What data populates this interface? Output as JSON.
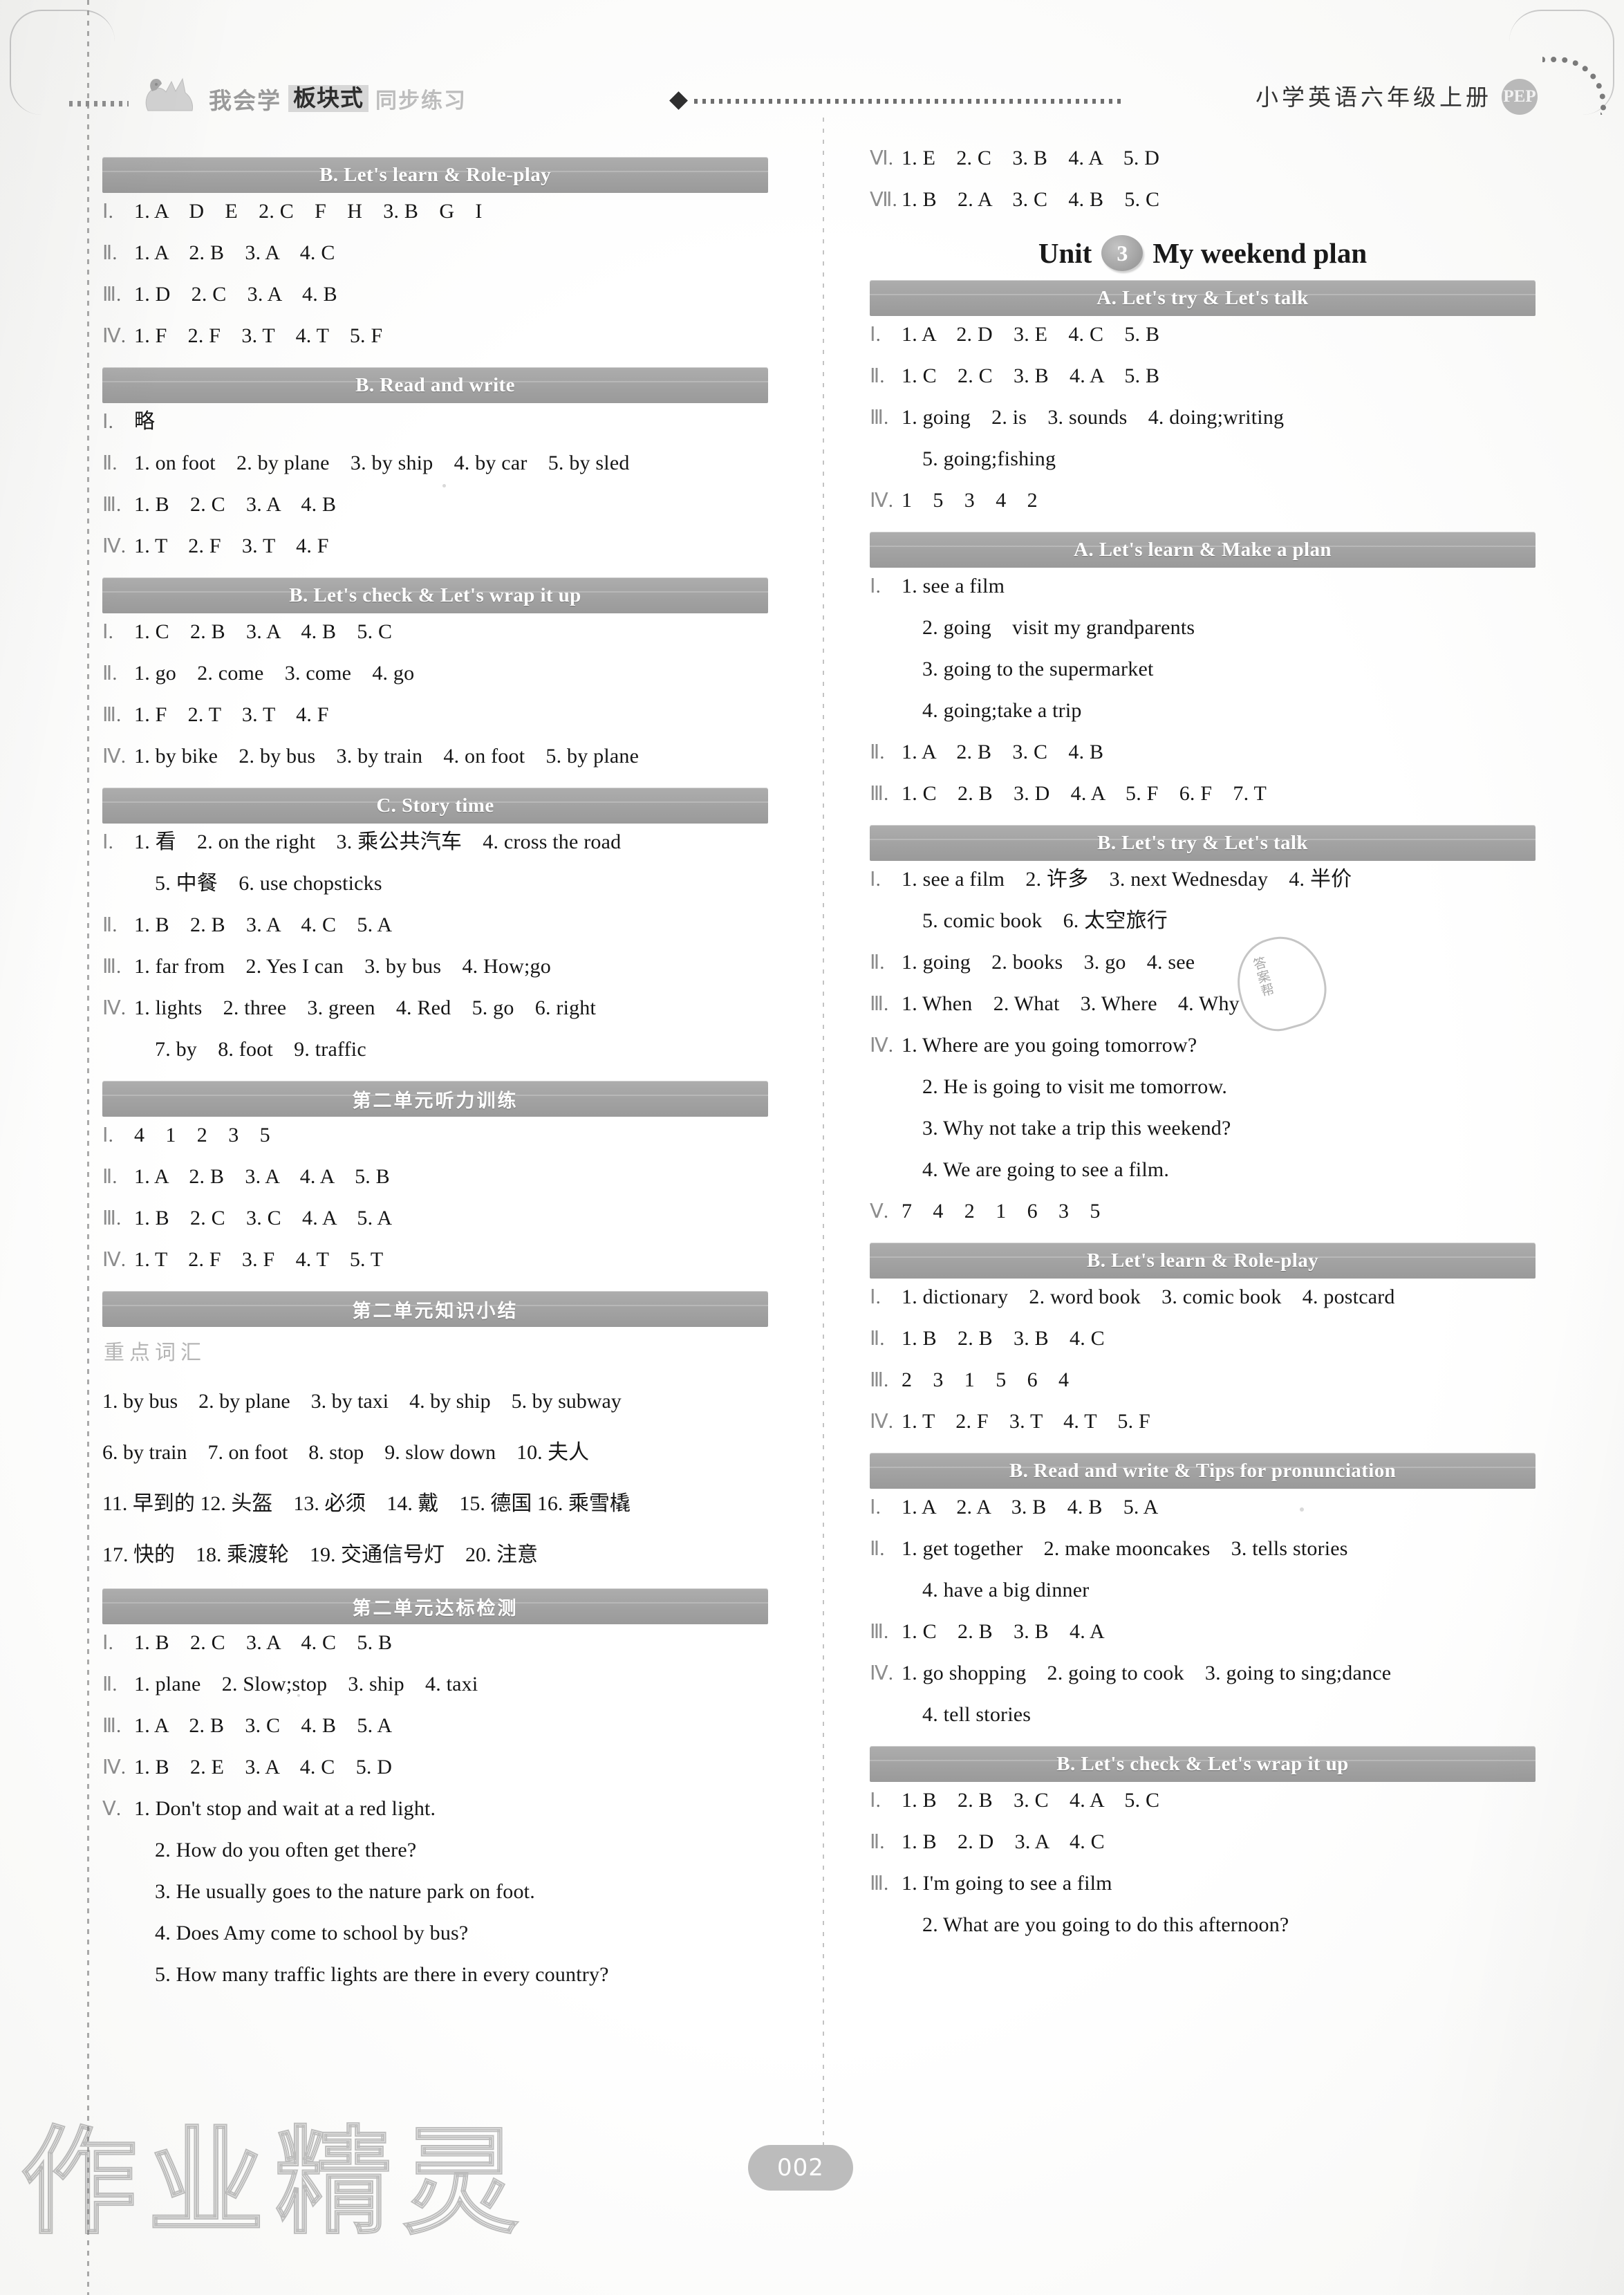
{
  "header": {
    "logo_cn": "我会学",
    "badge_cn": "板块式",
    "sub_cn": "同步练习",
    "book_title": "小学英语六年级上册",
    "publisher_badge": "PEP"
  },
  "page_number": "002",
  "watermark": {
    "text": "作业精灵",
    "stamp": "答案帮"
  },
  "left_column": [
    {
      "type": "banner",
      "label": "B. Let's learn & Role-play"
    },
    {
      "type": "row",
      "num": "Ⅰ",
      "answer": "1. A　D　E　2. C　F　H　3. B　G　I"
    },
    {
      "type": "row",
      "num": "Ⅱ",
      "answer": "1. A　2. B　3. A　4. C"
    },
    {
      "type": "row",
      "num": "Ⅲ",
      "answer": "1. D　2. C　3. A　4. B"
    },
    {
      "type": "row",
      "num": "Ⅳ",
      "answer": "1. F　2. F　3. T　4. T　5. F"
    },
    {
      "type": "banner",
      "label": "B. Read and write"
    },
    {
      "type": "row",
      "num": "Ⅰ",
      "answer": "略"
    },
    {
      "type": "row",
      "num": "Ⅱ",
      "answer": "1. on foot　2. by plane　3. by ship　4. by car　5. by sled"
    },
    {
      "type": "row",
      "num": "Ⅲ",
      "answer": "1. B　2. C　3. A　4. B"
    },
    {
      "type": "row",
      "num": "Ⅳ",
      "answer": "1. T　2. F　3. T　4. F"
    },
    {
      "type": "banner",
      "label": "B. Let's check & Let's wrap it up"
    },
    {
      "type": "row",
      "num": "Ⅰ",
      "answer": "1. C　2. B　3. A　4. B　5. C"
    },
    {
      "type": "row",
      "num": "Ⅱ",
      "answer": "1. go　2. come　3. come　4. go"
    },
    {
      "type": "row",
      "num": "Ⅲ",
      "answer": "1. F　2. T　3. T　4. F"
    },
    {
      "type": "row",
      "num": "Ⅳ",
      "answer": "1. by bike　2. by bus　3. by train　4. on foot　5. by plane"
    },
    {
      "type": "banner",
      "label": "C. Story time"
    },
    {
      "type": "row",
      "num": "Ⅰ",
      "answer": "1. 看　2. on the right　3. 乘公共汽车　4. cross the road"
    },
    {
      "type": "cont",
      "answer": "5. 中餐　6. use chopsticks"
    },
    {
      "type": "row",
      "num": "Ⅱ",
      "answer": "1. B　2. B　3. A　4. C　5. A"
    },
    {
      "type": "row",
      "num": "Ⅲ",
      "answer": "1. far from　2. Yes I can　3. by bus　4. How;go"
    },
    {
      "type": "row",
      "num": "Ⅳ",
      "answer": "1. lights　2. three　3. green　4. Red　5. go　6. right"
    },
    {
      "type": "cont",
      "answer": "7. by　8. foot　9. traffic"
    },
    {
      "type": "banner",
      "label": "第二单元听力训练",
      "cn": true
    },
    {
      "type": "row",
      "num": "Ⅰ",
      "answer": "4　1　2　3　5"
    },
    {
      "type": "row",
      "num": "Ⅱ",
      "answer": "1. A　2. B　3. A　4. A　5. B"
    },
    {
      "type": "row",
      "num": "Ⅲ",
      "answer": "1. B　2. C　3. C　4. A　5. A"
    },
    {
      "type": "row",
      "num": "Ⅳ",
      "answer": "1. T　2. F　3. F　4. T　5. T"
    },
    {
      "type": "banner",
      "label": "第二单元知识小结",
      "cn": true
    },
    {
      "type": "subhead",
      "answer": "重点词汇"
    },
    {
      "type": "plain",
      "answer": "1. by bus　2. by plane　3. by taxi　4. by ship　5. by subway"
    },
    {
      "type": "plain",
      "answer": "6. by train　7. on foot　8. stop　9. slow down　10. 夫人"
    },
    {
      "type": "plain",
      "answer": "11. 早到的  12. 头盔　13. 必须　14. 戴　15. 德国 16. 乘雪橇"
    },
    {
      "type": "plain",
      "answer": "17. 快的　18. 乘渡轮　19. 交通信号灯　20. 注意"
    },
    {
      "type": "banner",
      "label": "第二单元达标检测",
      "cn": true
    },
    {
      "type": "row",
      "num": "Ⅰ",
      "answer": "1. B　2. C　3. A　4. C　5. B"
    },
    {
      "type": "row",
      "num": "Ⅱ",
      "answer": "1. plane　2. Slow;stop　3. ship　4. taxi"
    },
    {
      "type": "row",
      "num": "Ⅲ",
      "answer": "1. A　2. B　3. C　4. B　5. A"
    },
    {
      "type": "row",
      "num": "Ⅳ",
      "answer": "1. B　2. E　3. A　4. C　5. D"
    },
    {
      "type": "row",
      "num": "Ⅴ",
      "answer": "1. Don't stop and wait at a red light."
    },
    {
      "type": "cont",
      "answer": "2. How do you often get there?"
    },
    {
      "type": "cont",
      "answer": "3. He usually goes to the nature park on foot."
    },
    {
      "type": "cont",
      "answer": "4. Does Amy come to school by bus?"
    },
    {
      "type": "cont",
      "answer": "5. How many traffic lights are there in every country?"
    }
  ],
  "right_column": [
    {
      "type": "row",
      "num": "Ⅵ",
      "answer": "1. E　2. C　3. B　4. A　5. D"
    },
    {
      "type": "row",
      "num": "Ⅶ",
      "answer": "1. B　2. A　3. C　4. B　5. C"
    },
    {
      "type": "unit",
      "word": "Unit",
      "number": "3",
      "title": "My weekend plan"
    },
    {
      "type": "banner",
      "label": "A. Let's try & Let's talk"
    },
    {
      "type": "row",
      "num": "Ⅰ",
      "answer": "1. A　2. D　3. E　4. C　5. B"
    },
    {
      "type": "row",
      "num": "Ⅱ",
      "answer": "1. C　2. C　3. B　4. A　5. B"
    },
    {
      "type": "row",
      "num": "Ⅲ",
      "answer": "1. going　2. is　3. sounds　4. doing;writing"
    },
    {
      "type": "cont",
      "answer": "5. going;fishing"
    },
    {
      "type": "row",
      "num": "Ⅳ",
      "answer": "1　5　3　4　2"
    },
    {
      "type": "banner",
      "label": "A. Let's learn & Make a plan"
    },
    {
      "type": "row",
      "num": "Ⅰ",
      "answer": "1. see a film"
    },
    {
      "type": "cont",
      "answer": "2. going　visit my grandparents"
    },
    {
      "type": "cont",
      "answer": "3. going to the supermarket"
    },
    {
      "type": "cont",
      "answer": "4. going;take a trip"
    },
    {
      "type": "row",
      "num": "Ⅱ",
      "answer": "1. A　2. B　3. C　4. B"
    },
    {
      "type": "row",
      "num": "Ⅲ",
      "answer": "1. C　2. B　3. D　4. A　5. F　6. F　7. T"
    },
    {
      "type": "banner",
      "label": "B. Let's try & Let's talk"
    },
    {
      "type": "row",
      "num": "Ⅰ",
      "answer": "1. see a film　2. 许多　3. next Wednesday　4. 半价"
    },
    {
      "type": "cont",
      "answer": "5. comic book　6. 太空旅行"
    },
    {
      "type": "row",
      "num": "Ⅱ",
      "answer": "1. going　2. books　3. go　4. see"
    },
    {
      "type": "row",
      "num": "Ⅲ",
      "answer": "1. When　2. What　3. Where　4. Why"
    },
    {
      "type": "row",
      "num": "Ⅳ",
      "answer": "1. Where are you going tomorrow?"
    },
    {
      "type": "cont",
      "answer": "2. He is going to visit me tomorrow."
    },
    {
      "type": "cont",
      "answer": "3. Why not take a trip this weekend?"
    },
    {
      "type": "cont",
      "answer": "4. We are going to see a film."
    },
    {
      "type": "row",
      "num": "Ⅴ",
      "answer": "7　4　2　1　6　3　5"
    },
    {
      "type": "banner",
      "label": "B. Let's learn & Role-play"
    },
    {
      "type": "row",
      "num": "Ⅰ",
      "answer": "1. dictionary　2. word book　3. comic book　4. postcard"
    },
    {
      "type": "row",
      "num": "Ⅱ",
      "answer": "1. B　2. B　3. B　4. C"
    },
    {
      "type": "row",
      "num": "Ⅲ",
      "answer": "2　3　1　5　6　4"
    },
    {
      "type": "row",
      "num": "Ⅳ",
      "answer": "1. T　2. F　3. T　4. T　5. F"
    },
    {
      "type": "banner",
      "label": "B. Read and write & Tips for pronunciation"
    },
    {
      "type": "row",
      "num": "Ⅰ",
      "answer": "1. A　2. A　3. B　4. B　5. A"
    },
    {
      "type": "row",
      "num": "Ⅱ",
      "answer": "1. get together　2. make mooncakes　3. tells stories"
    },
    {
      "type": "cont",
      "answer": "4. have a big dinner"
    },
    {
      "type": "row",
      "num": "Ⅲ",
      "answer": "1. C　2. B　3. B　4. A"
    },
    {
      "type": "row",
      "num": "Ⅳ",
      "answer": "1. go shopping　2. going to cook　3. going to sing;dance"
    },
    {
      "type": "cont",
      "answer": "4. tell stories"
    },
    {
      "type": "banner",
      "label": "B. Let's check & Let's wrap it up"
    },
    {
      "type": "row",
      "num": "Ⅰ",
      "answer": "1. B　2. B　3. C　4. A　5. C"
    },
    {
      "type": "row",
      "num": "Ⅱ",
      "answer": "1. B　2. D　3. A　4. C"
    },
    {
      "type": "row",
      "num": "Ⅲ",
      "answer": "1. I'm going to see a film"
    },
    {
      "type": "cont",
      "answer": "2. What are you going to do this afternoon?"
    }
  ]
}
